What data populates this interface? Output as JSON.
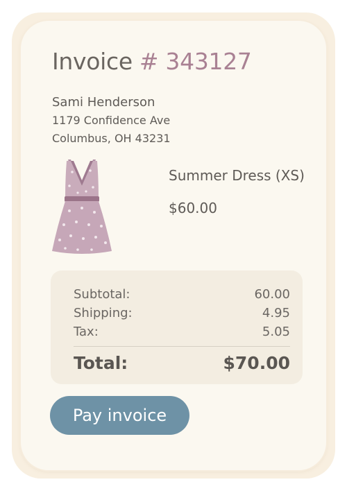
{
  "invoice": {
    "label": "Invoice",
    "number": "# 343127"
  },
  "customer": {
    "name": "Sami Henderson",
    "street": "1179 Confidence Ave",
    "city": "Columbus, OH 43231"
  },
  "item": {
    "name": "Summer Dress (XS)",
    "price": "$60.00",
    "image_icon": "dress-icon"
  },
  "summary": {
    "subtotal_label": "Subtotal:",
    "subtotal_value": "60.00",
    "shipping_label": "Shipping:",
    "shipping_value": "4.95",
    "tax_label": "Tax:",
    "tax_value": "5.05",
    "total_label": "Total:",
    "total_value": "$70.00"
  },
  "actions": {
    "pay_label": "Pay invoice"
  },
  "colors": {
    "accent_button": "#6e92a6",
    "invoice_number": "#a98193",
    "dress": "#c2a4b5"
  }
}
